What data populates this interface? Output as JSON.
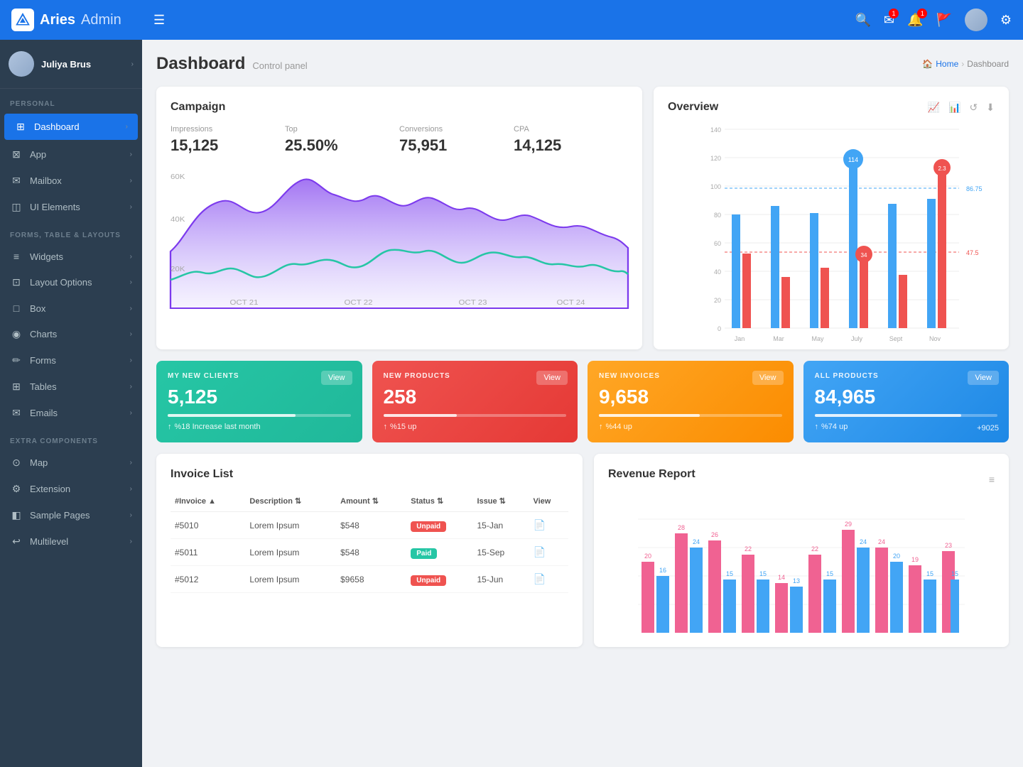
{
  "app": {
    "name_aries": "Aries",
    "name_admin": "Admin",
    "hamburger": "☰"
  },
  "topnav": {
    "icons": [
      "search",
      "mail",
      "bell",
      "flag",
      "avatar",
      "gear"
    ],
    "mail_badge": "1",
    "bell_badge": "1"
  },
  "sidebar": {
    "user_name": "Juliya Brus",
    "sections": [
      {
        "label": "PERSONAL",
        "items": [
          {
            "icon": "⊞",
            "label": "Dashboard",
            "active": true
          },
          {
            "icon": "⊠",
            "label": "App"
          },
          {
            "icon": "✉",
            "label": "Mailbox"
          },
          {
            "icon": "◫",
            "label": "UI Elements"
          }
        ]
      },
      {
        "label": "FORMS, TABLE & LAYOUTS",
        "items": [
          {
            "icon": "≡",
            "label": "Widgets"
          },
          {
            "icon": "⊡",
            "label": "Layout Options"
          },
          {
            "icon": "□",
            "label": "Box"
          },
          {
            "icon": "◉",
            "label": "Charts"
          },
          {
            "icon": "✏",
            "label": "Forms"
          },
          {
            "icon": "⊞",
            "label": "Tables"
          },
          {
            "icon": "✉",
            "label": "Emails"
          }
        ]
      },
      {
        "label": "EXTRA COMPONENTS",
        "items": [
          {
            "icon": "⊙",
            "label": "Map"
          },
          {
            "icon": "⚙",
            "label": "Extension"
          },
          {
            "icon": "◧",
            "label": "Sample Pages"
          },
          {
            "icon": "↩",
            "label": "Multilevel"
          }
        ]
      }
    ]
  },
  "page": {
    "title": "Dashboard",
    "subtitle": "Control panel",
    "breadcrumb_home": "Home",
    "breadcrumb_current": "Dashboard"
  },
  "campaign": {
    "title": "Campaign",
    "stats": [
      {
        "label": "Impressions",
        "value": "15,125"
      },
      {
        "label": "Top",
        "value": "25.50%"
      },
      {
        "label": "Conversions",
        "value": "75,951"
      },
      {
        "label": "CPA",
        "value": "14,125"
      }
    ],
    "chart_label_60k": "60K",
    "chart_label_40k": "40K",
    "chart_label_20k": "20K",
    "chart_dates": [
      "OCT 21",
      "OCT 22",
      "OCT 23",
      "OCT 24"
    ]
  },
  "overview": {
    "title": "Overview",
    "y_labels": [
      "0",
      "20",
      "40",
      "60",
      "80",
      "100",
      "120",
      "140"
    ],
    "x_labels": [
      "Jan",
      "Mar",
      "May",
      "July",
      "Sept",
      "Nov"
    ],
    "tooltip1": "114",
    "tooltip2": "86.75",
    "tooltip3": "34",
    "tooltip4": "47.5",
    "tooltip5": "2.3"
  },
  "stat_cards": [
    {
      "color": "green",
      "title": "MY NEW CLIENTS",
      "value": "5,125",
      "bar_pct": 70,
      "footer": "%18 Increase last month",
      "btn": "View"
    },
    {
      "color": "red",
      "title": "NEW PRODUCTS",
      "value": "258",
      "bar_pct": 40,
      "footer": "%15 up",
      "btn": "View"
    },
    {
      "color": "yellow",
      "title": "NEW INVOICES",
      "value": "9,658",
      "bar_pct": 55,
      "footer": "%44 up",
      "btn": "View"
    },
    {
      "color": "blue",
      "title": "ALL PRODUCTS",
      "value": "84,965",
      "bar_pct": 80,
      "footer": "%74 up",
      "extra": "+9025",
      "btn": "View"
    }
  ],
  "invoice_list": {
    "title": "Invoice List",
    "columns": [
      "#Invoice",
      "Description",
      "Amount",
      "Status",
      "Issue",
      "View"
    ],
    "rows": [
      {
        "invoice": "#5010",
        "desc": "Lorem Ipsum",
        "amount": "$548",
        "status": "Unpaid",
        "issue": "15-Jan"
      },
      {
        "invoice": "#5011",
        "desc": "Lorem Ipsum",
        "amount": "$548",
        "status": "Paid",
        "issue": "15-Sep"
      },
      {
        "invoice": "#5012",
        "desc": "Lorem Ipsum",
        "amount": "$9658",
        "status": "Unpaid",
        "issue": "15-Jun"
      }
    ]
  },
  "revenue": {
    "title": "Revenue Report",
    "bars_pink": [
      20,
      28,
      26,
      22,
      14,
      22,
      29,
      24,
      19,
      23
    ],
    "bars_blue": [
      16,
      24,
      15,
      15,
      13,
      15,
      24,
      20,
      15,
      15
    ],
    "labels_pink": [
      "20",
      "28",
      "26",
      "22",
      "14",
      "22",
      "29",
      "24",
      "19",
      "23"
    ],
    "labels_blue": [
      "16",
      "24",
      "15",
      "15",
      "13",
      "15",
      "24",
      "20",
      "15",
      "15"
    ]
  }
}
